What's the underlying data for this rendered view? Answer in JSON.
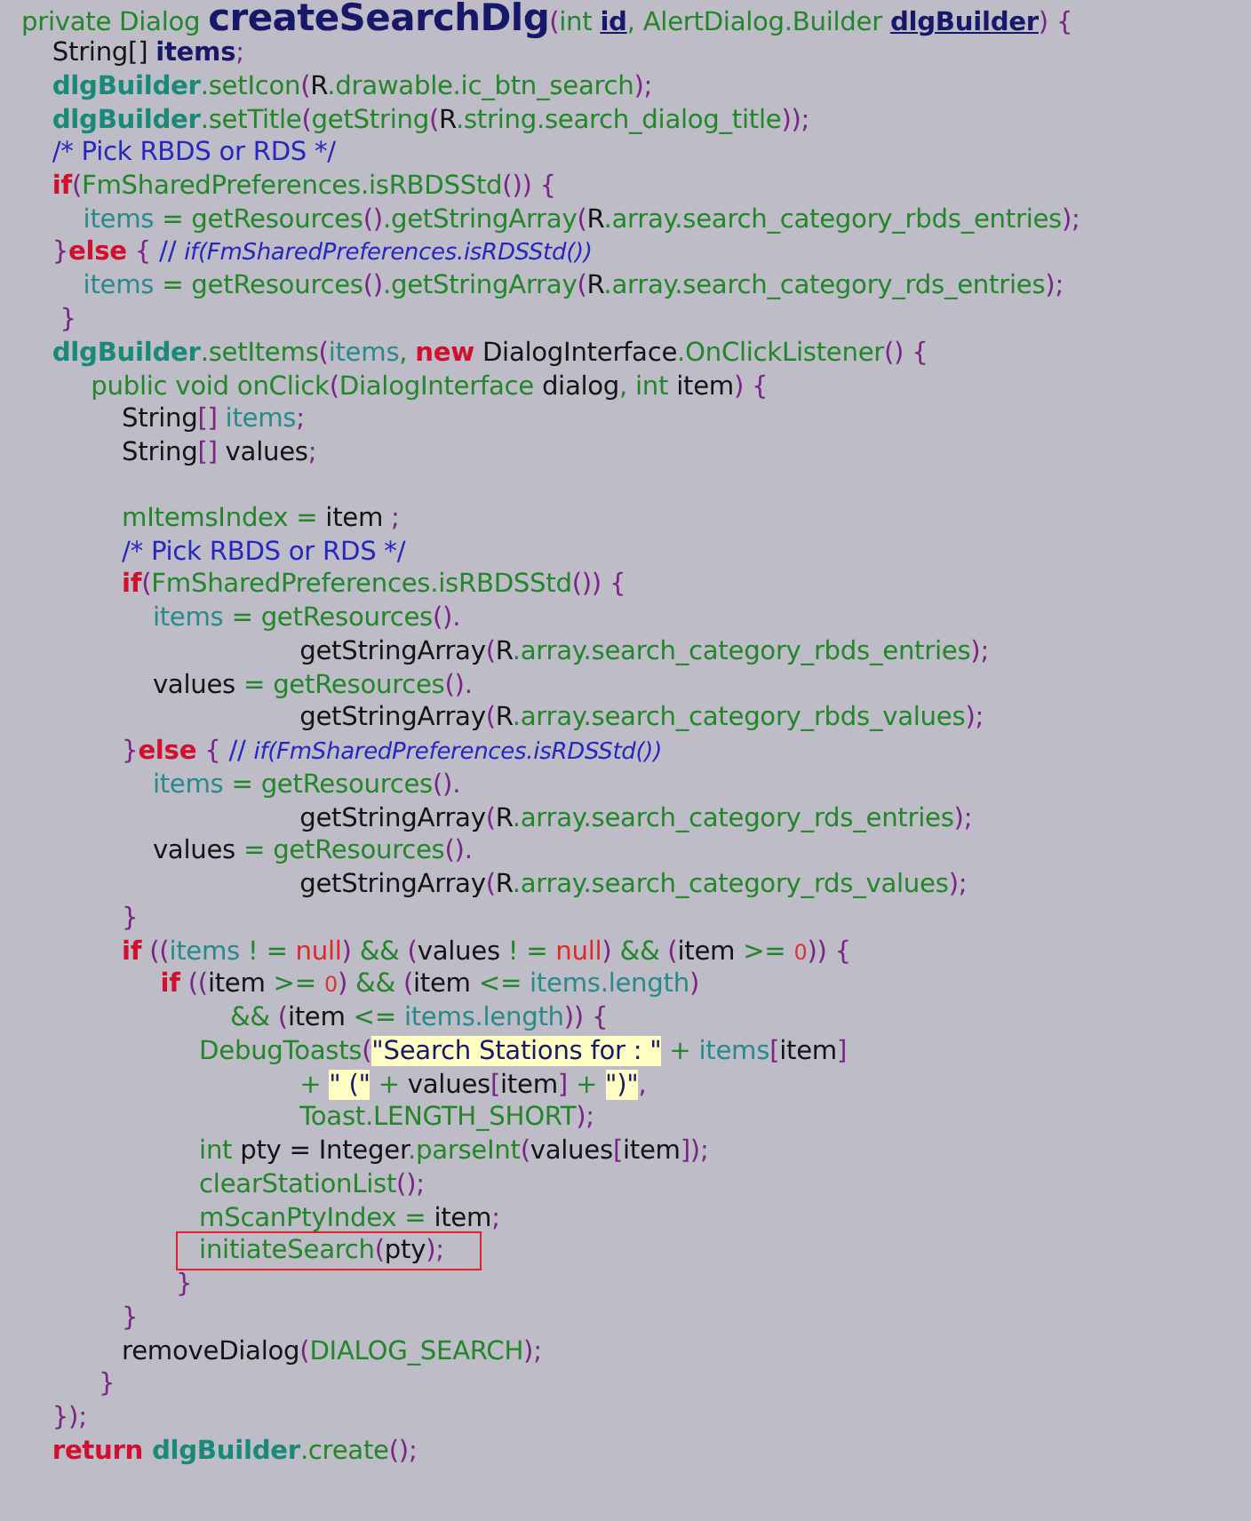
{
  "code_lines": [
    {
      "tokens": [
        {
          "kind": "green",
          "text": "private Dialog "
        },
        {
          "kind": "title",
          "text": "createSearchDlg"
        },
        {
          "kind": "punct",
          "text": "("
        },
        {
          "kind": "green",
          "text": "int "
        },
        {
          "kind": "param",
          "text": "id"
        },
        {
          "kind": "green",
          "text": ", AlertDialog.Builder "
        },
        {
          "kind": "param",
          "text": "dlgBuilder"
        },
        {
          "kind": "punct",
          "text": ") {"
        }
      ]
    },
    {
      "tokens": [
        {
          "kind": "plain",
          "text": "    String[] "
        },
        {
          "kind": "bold",
          "text": "items"
        },
        {
          "kind": "punct",
          "text": ";"
        }
      ]
    },
    {
      "tokens": [
        {
          "kind": "member",
          "text": "    dlgBuilder"
        },
        {
          "kind": "green",
          "text": ".setIcon"
        },
        {
          "kind": "punct",
          "text": "("
        },
        {
          "kind": "plain",
          "text": "R"
        },
        {
          "kind": "green",
          "text": ".drawable.ic_btn_search"
        },
        {
          "kind": "punct",
          "text": ");"
        }
      ]
    },
    {
      "tokens": [
        {
          "kind": "member",
          "text": "    dlgBuilder"
        },
        {
          "kind": "green",
          "text": ".setTitle"
        },
        {
          "kind": "punct",
          "text": "("
        },
        {
          "kind": "green",
          "text": "getString"
        },
        {
          "kind": "punct",
          "text": "("
        },
        {
          "kind": "plain",
          "text": "R"
        },
        {
          "kind": "green",
          "text": ".string.search_dialog_title"
        },
        {
          "kind": "punct",
          "text": "));"
        }
      ]
    },
    {
      "tokens": [
        {
          "kind": "comment",
          "text": "    /* Pick RBDS or RDS */"
        }
      ]
    },
    {
      "tokens": [
        {
          "kind": "keyword",
          "text": "    if"
        },
        {
          "kind": "punct",
          "text": "("
        },
        {
          "kind": "green",
          "text": "FmSharedPreferences.isRBDSStd"
        },
        {
          "kind": "punct",
          "text": "()) {"
        }
      ]
    },
    {
      "tokens": [
        {
          "kind": "field",
          "text": "        items"
        },
        {
          "kind": "green",
          "text": " = getResources"
        },
        {
          "kind": "punct",
          "text": "()"
        },
        {
          "kind": "green",
          "text": ".getStringArray"
        },
        {
          "kind": "punct",
          "text": "("
        },
        {
          "kind": "plain",
          "text": "R"
        },
        {
          "kind": "green",
          "text": ".array.search_category_rbds_entries"
        },
        {
          "kind": "punct",
          "text": ");"
        }
      ]
    },
    {
      "tokens": [
        {
          "kind": "punct",
          "text": "    }"
        },
        {
          "kind": "keyword",
          "text": "else"
        },
        {
          "kind": "punct",
          "text": " { "
        },
        {
          "kind": "comment",
          "text": "// "
        },
        {
          "kind": "note",
          "text": "if(FmSharedPreferences.isRDSStd())"
        }
      ]
    },
    {
      "tokens": [
        {
          "kind": "field",
          "text": "        items"
        },
        {
          "kind": "green",
          "text": " = getResources"
        },
        {
          "kind": "punct",
          "text": "()"
        },
        {
          "kind": "green",
          "text": ".getStringArray"
        },
        {
          "kind": "punct",
          "text": "("
        },
        {
          "kind": "plain",
          "text": "R"
        },
        {
          "kind": "green",
          "text": ".array.search_category_rds_entries"
        },
        {
          "kind": "punct",
          "text": ");"
        }
      ]
    },
    {
      "tokens": [
        {
          "kind": "punct",
          "text": "     }"
        }
      ]
    },
    {
      "tokens": [
        {
          "kind": "member",
          "text": "    dlgBuilder"
        },
        {
          "kind": "green",
          "text": ".setItems"
        },
        {
          "kind": "punct",
          "text": "("
        },
        {
          "kind": "field",
          "text": "items"
        },
        {
          "kind": "green",
          "text": ", "
        },
        {
          "kind": "keyword",
          "text": "new"
        },
        {
          "kind": "plain",
          "text": " DialogInterface"
        },
        {
          "kind": "green",
          "text": ".OnClickListener"
        },
        {
          "kind": "punct",
          "text": "() {"
        }
      ]
    },
    {
      "tokens": [
        {
          "kind": "green",
          "text": "         public void onClick"
        },
        {
          "kind": "punct",
          "text": "("
        },
        {
          "kind": "green",
          "text": "DialogInterface "
        },
        {
          "kind": "plain",
          "text": "dialog"
        },
        {
          "kind": "green",
          "text": ", int "
        },
        {
          "kind": "plain",
          "text": "item"
        },
        {
          "kind": "punct",
          "text": ") {"
        }
      ]
    },
    {
      "tokens": [
        {
          "kind": "plain",
          "text": "             String"
        },
        {
          "kind": "punct",
          "text": "[]"
        },
        {
          "kind": "field",
          "text": " items"
        },
        {
          "kind": "punct",
          "text": ";"
        }
      ]
    },
    {
      "tokens": [
        {
          "kind": "plain",
          "text": "             String"
        },
        {
          "kind": "punct",
          "text": "[]"
        },
        {
          "kind": "plain",
          "text": " values"
        },
        {
          "kind": "punct",
          "text": ";"
        }
      ]
    },
    {
      "gap_before": true,
      "tokens": [
        {
          "kind": "green",
          "text": "             mItemsIndex = "
        },
        {
          "kind": "plain",
          "text": "item"
        },
        {
          "kind": "punct",
          "text": " ;"
        }
      ]
    },
    {
      "tokens": [
        {
          "kind": "comment",
          "text": "             /* Pick RBDS or RDS */"
        }
      ]
    },
    {
      "tokens": [
        {
          "kind": "keyword",
          "text": "             if"
        },
        {
          "kind": "punct",
          "text": "("
        },
        {
          "kind": "green",
          "text": "FmSharedPreferences.isRBDSStd"
        },
        {
          "kind": "punct",
          "text": "()) {"
        }
      ]
    },
    {
      "tokens": [
        {
          "kind": "field",
          "text": "                 items"
        },
        {
          "kind": "green",
          "text": " = getResources"
        },
        {
          "kind": "punct",
          "text": "()."
        }
      ]
    },
    {
      "tokens": [
        {
          "kind": "plain",
          "text": "                                    getStringArray"
        },
        {
          "kind": "punct",
          "text": "("
        },
        {
          "kind": "plain",
          "text": "R"
        },
        {
          "kind": "green",
          "text": ".array.search_category_rbds_entries"
        },
        {
          "kind": "punct",
          "text": ");"
        }
      ]
    },
    {
      "tokens": [
        {
          "kind": "plain",
          "text": "                 values"
        },
        {
          "kind": "green",
          "text": " = getResources"
        },
        {
          "kind": "punct",
          "text": "()."
        }
      ]
    },
    {
      "tokens": [
        {
          "kind": "plain",
          "text": "                                    getStringArray"
        },
        {
          "kind": "punct",
          "text": "("
        },
        {
          "kind": "plain",
          "text": "R"
        },
        {
          "kind": "green",
          "text": ".array.search_category_rbds_values"
        },
        {
          "kind": "punct",
          "text": ");"
        }
      ]
    },
    {
      "tokens": [
        {
          "kind": "punct",
          "text": "             }"
        },
        {
          "kind": "keyword",
          "text": "else"
        },
        {
          "kind": "punct",
          "text": " { "
        },
        {
          "kind": "comment",
          "text": "// "
        },
        {
          "kind": "note",
          "text": "if(FmSharedPreferences.isRDSStd())"
        }
      ]
    },
    {
      "tokens": [
        {
          "kind": "field",
          "text": "                 items"
        },
        {
          "kind": "green",
          "text": " = getResources"
        },
        {
          "kind": "punct",
          "text": "()."
        }
      ]
    },
    {
      "tokens": [
        {
          "kind": "plain",
          "text": "                                    getStringArray"
        },
        {
          "kind": "punct",
          "text": "("
        },
        {
          "kind": "plain",
          "text": "R"
        },
        {
          "kind": "green",
          "text": ".array.search_category_rds_entries"
        },
        {
          "kind": "punct",
          "text": ");"
        }
      ]
    },
    {
      "tokens": [
        {
          "kind": "plain",
          "text": "                 values"
        },
        {
          "kind": "green",
          "text": " = getResources"
        },
        {
          "kind": "punct",
          "text": "()."
        }
      ]
    },
    {
      "tokens": [
        {
          "kind": "plain",
          "text": "                                    getStringArray"
        },
        {
          "kind": "punct",
          "text": "("
        },
        {
          "kind": "plain",
          "text": "R"
        },
        {
          "kind": "green",
          "text": ".array.search_category_rds_values"
        },
        {
          "kind": "punct",
          "text": ");"
        }
      ]
    },
    {
      "tokens": [
        {
          "kind": "punct",
          "text": "             }"
        }
      ]
    },
    {
      "tokens": [
        {
          "kind": "keyword",
          "text": "             if"
        },
        {
          "kind": "punct",
          "text": " (("
        },
        {
          "kind": "field",
          "text": "items"
        },
        {
          "kind": "green",
          "text": " ! = "
        },
        {
          "kind": "null",
          "text": "null"
        },
        {
          "kind": "punct",
          "text": ")"
        },
        {
          "kind": "green",
          "text": " && "
        },
        {
          "kind": "punct",
          "text": "("
        },
        {
          "kind": "plain",
          "text": "values"
        },
        {
          "kind": "green",
          "text": " ! = "
        },
        {
          "kind": "null",
          "text": "null"
        },
        {
          "kind": "punct",
          "text": ")"
        },
        {
          "kind": "green",
          "text": " && "
        },
        {
          "kind": "punct",
          "text": "("
        },
        {
          "kind": "plain",
          "text": "item"
        },
        {
          "kind": "green",
          "text": " >= "
        },
        {
          "kind": "number",
          "text": "0"
        },
        {
          "kind": "punct",
          "text": ")) {"
        }
      ]
    },
    {
      "tokens": [
        {
          "kind": "keyword",
          "text": "                  if"
        },
        {
          "kind": "punct",
          "text": " (("
        },
        {
          "kind": "plain",
          "text": "item"
        },
        {
          "kind": "green",
          "text": " >= "
        },
        {
          "kind": "number",
          "text": "0"
        },
        {
          "kind": "punct",
          "text": ")"
        },
        {
          "kind": "green",
          "text": " && "
        },
        {
          "kind": "punct",
          "text": "("
        },
        {
          "kind": "plain",
          "text": "item"
        },
        {
          "kind": "green",
          "text": " <= "
        },
        {
          "kind": "field",
          "text": "items.length"
        },
        {
          "kind": "punct",
          "text": ")"
        }
      ]
    },
    {
      "tokens": [
        {
          "kind": "green",
          "text": "                           && "
        },
        {
          "kind": "punct",
          "text": "("
        },
        {
          "kind": "plain",
          "text": "item"
        },
        {
          "kind": "green",
          "text": " <= "
        },
        {
          "kind": "field",
          "text": "items.length"
        },
        {
          "kind": "punct",
          "text": ")) {"
        }
      ]
    },
    {
      "tokens": [
        {
          "kind": "green",
          "text": "                       DebugToasts"
        },
        {
          "kind": "punct",
          "text": "("
        },
        {
          "kind": "string",
          "text": "\"Search Stations for : \""
        },
        {
          "kind": "green",
          "text": " + "
        },
        {
          "kind": "field",
          "text": "items"
        },
        {
          "kind": "punct",
          "text": "["
        },
        {
          "kind": "plain",
          "text": "item"
        },
        {
          "kind": "punct",
          "text": "]"
        }
      ]
    },
    {
      "tokens": [
        {
          "kind": "green",
          "text": "                                    + "
        },
        {
          "kind": "string",
          "text": "\" (\""
        },
        {
          "kind": "green",
          "text": " + "
        },
        {
          "kind": "plain",
          "text": "values"
        },
        {
          "kind": "punct",
          "text": "["
        },
        {
          "kind": "plain",
          "text": "item"
        },
        {
          "kind": "punct",
          "text": "]"
        },
        {
          "kind": "green",
          "text": " + "
        },
        {
          "kind": "string",
          "text": "\")\""
        },
        {
          "kind": "punct",
          "text": ","
        }
      ]
    },
    {
      "tokens": [
        {
          "kind": "green",
          "text": "                                    Toast.LENGTH_SHORT"
        },
        {
          "kind": "punct",
          "text": ");"
        }
      ]
    },
    {
      "tokens": [
        {
          "kind": "green",
          "text": "                       int "
        },
        {
          "kind": "plain",
          "text": "pty = Integer"
        },
        {
          "kind": "green",
          "text": ".parseInt"
        },
        {
          "kind": "punct",
          "text": "("
        },
        {
          "kind": "plain",
          "text": "values"
        },
        {
          "kind": "punct",
          "text": "["
        },
        {
          "kind": "plain",
          "text": "item"
        },
        {
          "kind": "punct",
          "text": "]);"
        }
      ]
    },
    {
      "tokens": [
        {
          "kind": "green",
          "text": "                       clearStationList"
        },
        {
          "kind": "punct",
          "text": "();"
        }
      ]
    },
    {
      "tokens": [
        {
          "kind": "green",
          "text": "                       mScanPtyIndex = "
        },
        {
          "kind": "plain",
          "text": "item"
        },
        {
          "kind": "punct",
          "text": ";"
        }
      ]
    },
    {
      "boxed": true,
      "tokens": [
        {
          "kind": "green",
          "text": "                       initiateSearch"
        },
        {
          "kind": "punct",
          "text": "("
        },
        {
          "kind": "plain",
          "text": "pty"
        },
        {
          "kind": "punct",
          "text": ");"
        }
      ]
    },
    {
      "tokens": [
        {
          "kind": "punct",
          "text": "                    }"
        }
      ]
    },
    {
      "tokens": [
        {
          "kind": "punct",
          "text": "             }"
        }
      ]
    },
    {
      "tokens": [
        {
          "kind": "plain",
          "text": "             removeDialog"
        },
        {
          "kind": "punct",
          "text": "("
        },
        {
          "kind": "green",
          "text": "DIALOG_SEARCH"
        },
        {
          "kind": "punct",
          "text": ");"
        }
      ]
    },
    {
      "tokens": [
        {
          "kind": "punct",
          "text": "          }"
        }
      ]
    },
    {
      "tokens": [
        {
          "kind": "punct",
          "text": "    });"
        }
      ]
    },
    {
      "tokens": [
        {
          "kind": "keyword",
          "text": "    return "
        },
        {
          "kind": "member",
          "text": "dlgBuilder"
        },
        {
          "kind": "green",
          "text": ".create"
        },
        {
          "kind": "punct",
          "text": "();"
        }
      ]
    }
  ]
}
